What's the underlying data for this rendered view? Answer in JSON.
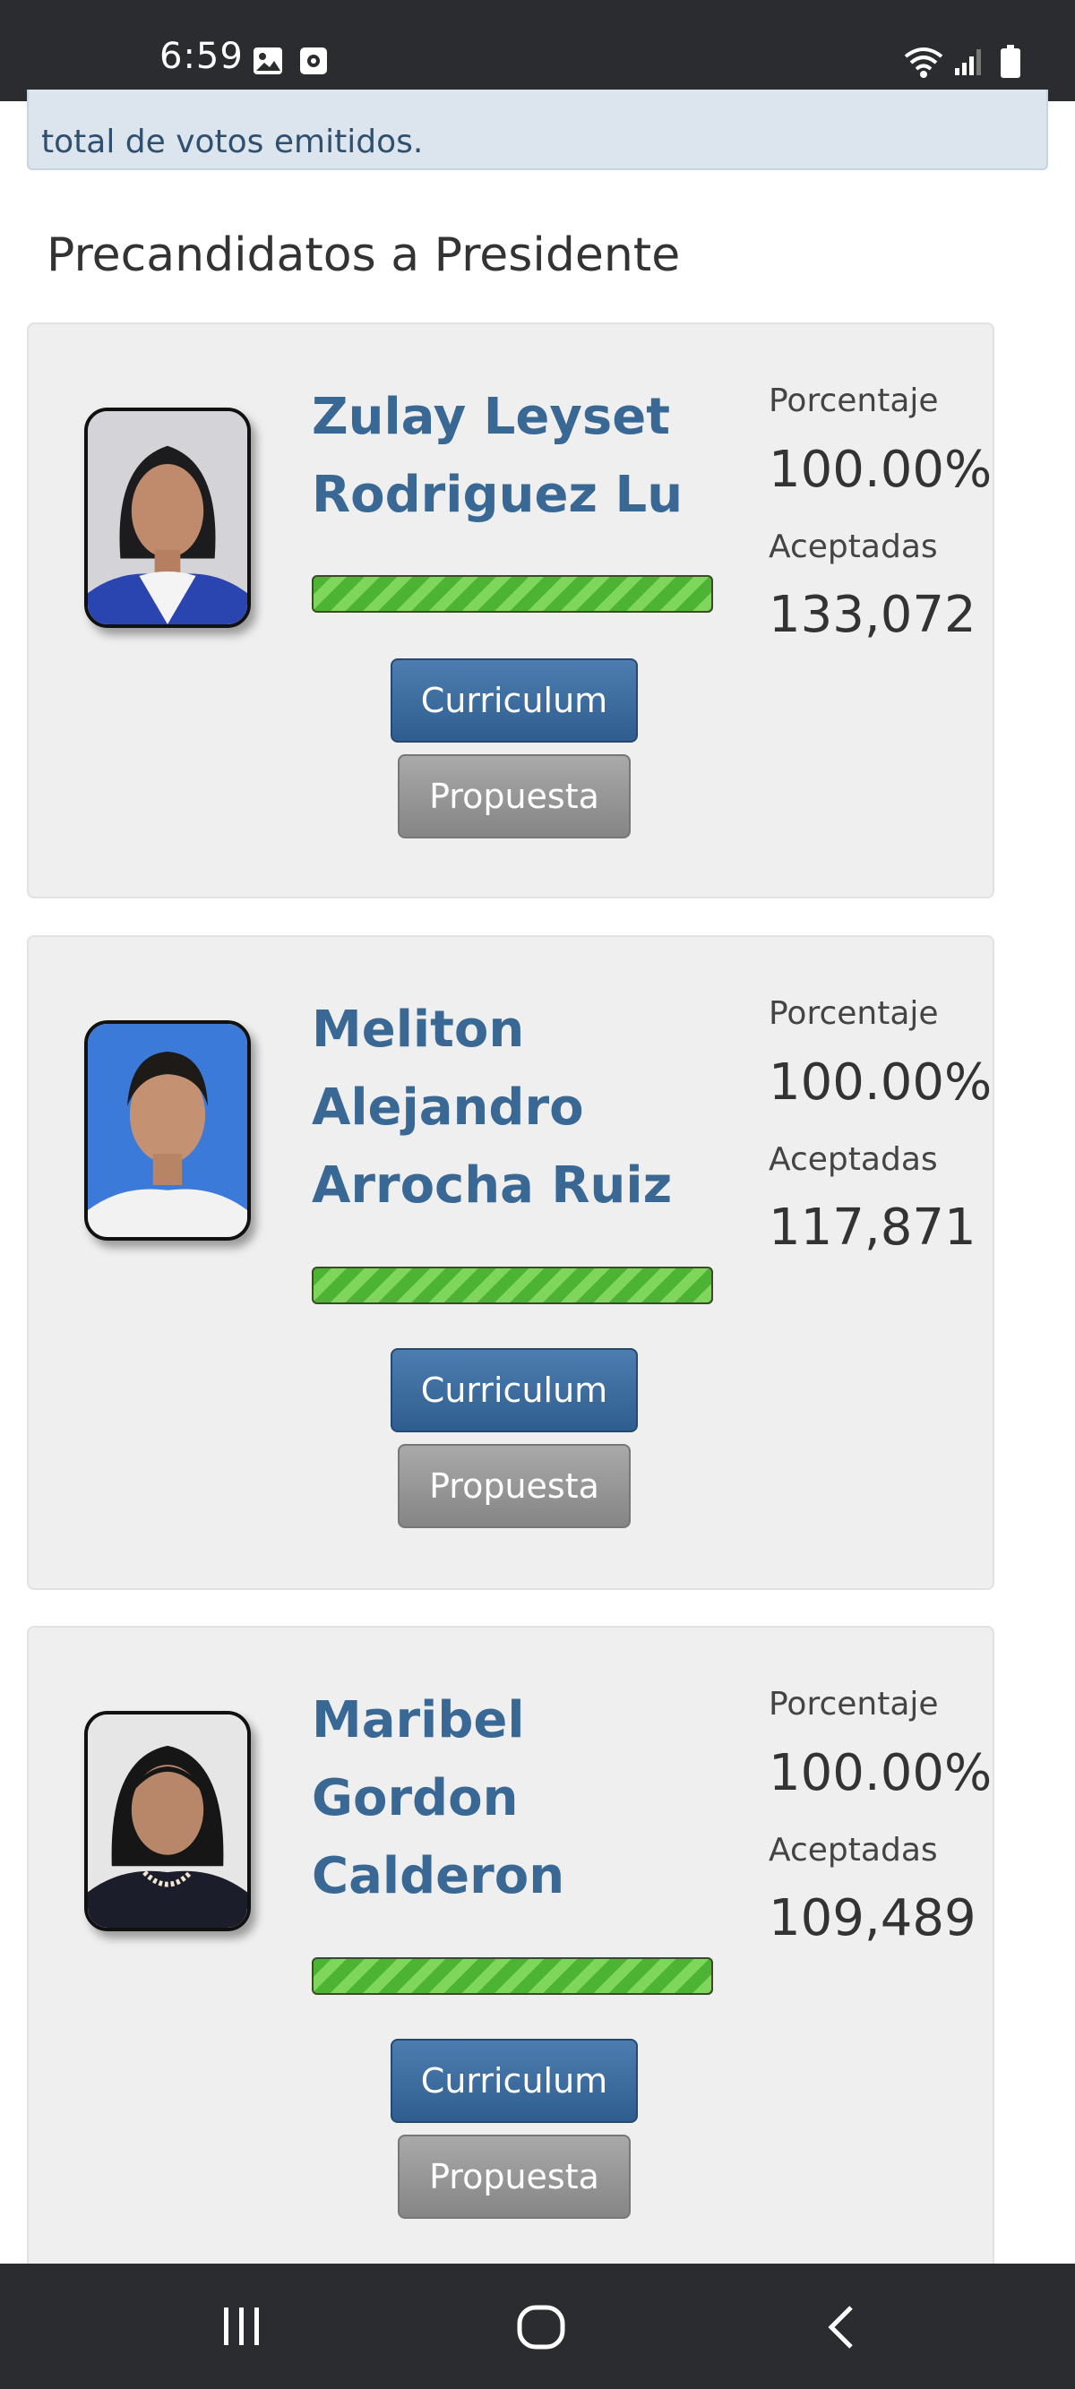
{
  "status_bar": {
    "time": "6:59",
    "left_icons": [
      "image-icon",
      "screenshot-icon"
    ],
    "right_icons": [
      "wifi-icon",
      "signal-icon",
      "battery-icon"
    ]
  },
  "info_box": {
    "visible_text": "total de votos emitidos."
  },
  "section_title": "Precandidatos a Presidente",
  "labels": {
    "percentage": "Porcentaje",
    "accepted": "Aceptadas",
    "curriculum_button": "Curriculum",
    "proposal_button": "Propuesta"
  },
  "candidates": [
    {
      "name_lines": [
        "Zulay Leyset",
        "Rodriguez Lu"
      ],
      "percentage": "100.00%",
      "accepted": "133,072",
      "progress_fraction": 1.0,
      "photo_background": "#d4d4d8"
    },
    {
      "name_lines": [
        "Meliton",
        "Alejandro",
        "Arrocha Ruiz"
      ],
      "percentage": "100.00%",
      "accepted": "117,871",
      "progress_fraction": 1.0,
      "photo_background": "#3b7ad8"
    },
    {
      "name_lines": [
        "Maribel",
        "Gordon",
        "Calderon"
      ],
      "percentage": "100.00%",
      "accepted": "109,489",
      "progress_fraction": 1.0,
      "photo_background": "#e6e6e6"
    }
  ],
  "nav_bar": {
    "buttons": [
      "recent-apps-icon",
      "home-icon",
      "back-icon"
    ]
  },
  "colors": {
    "name_blue": "#3a6894",
    "curriculum_blue": "#3a6a9c",
    "proposal_gray": "#999999",
    "progress_green": "#4cb432",
    "card_background": "#efefef"
  }
}
